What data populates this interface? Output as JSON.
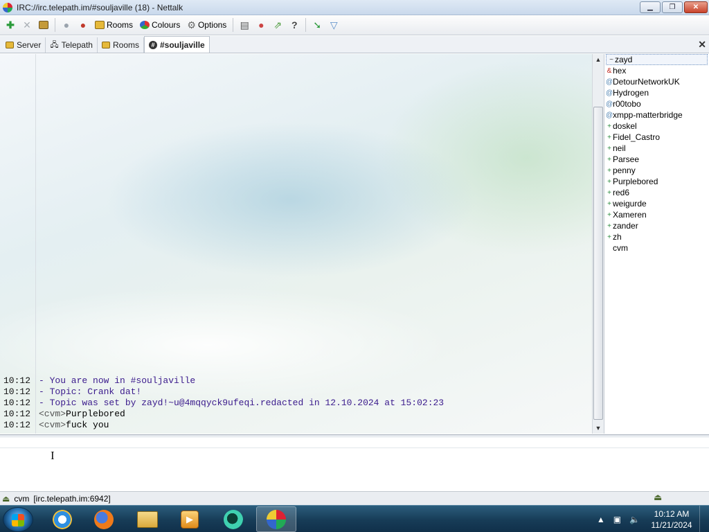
{
  "window": {
    "title": "IRC://irc.telepath.im/#souljaville (18)  -  Nettalk",
    "minimize": "▁",
    "maximize": "❐",
    "close": "✕"
  },
  "toolbar": {
    "rooms": "Rooms",
    "colours": "Colours",
    "options": "Options",
    "help": "?"
  },
  "tabs": [
    {
      "label": "Server"
    },
    {
      "label": "Telepath"
    },
    {
      "label": "Rooms"
    },
    {
      "label": "#souljaville"
    }
  ],
  "tab_close": "✕",
  "messages": [
    {
      "time": "10:12",
      "text": "- You are now in #souljaville"
    },
    {
      "time": "10:12",
      "text": "- Topic: Crank dat!"
    },
    {
      "time": "10:12",
      "text": "- Topic was set by zayd!~u@4mqqyck9ufeqi.redacted in 12.10.2024 at 15:02:23"
    },
    {
      "time": "10:12",
      "nick": "<cvm>",
      "body": "Purplebored"
    },
    {
      "time": "10:12",
      "nick": "<cvm>",
      "body": "fuck you"
    }
  ],
  "users": [
    {
      "mark": "~",
      "name": "zayd",
      "kind": "owner"
    },
    {
      "mark": "&",
      "name": "hex",
      "kind": "admin"
    },
    {
      "mark": "@",
      "name": "DetourNetworkUK",
      "kind": "op"
    },
    {
      "mark": "@",
      "name": "Hydrogen",
      "kind": "op"
    },
    {
      "mark": "@",
      "name": "r00tobo",
      "kind": "op"
    },
    {
      "mark": "@",
      "name": "xmpp-matterbridge",
      "kind": "op"
    },
    {
      "mark": "+",
      "name": "doskel",
      "kind": "voice"
    },
    {
      "mark": "+",
      "name": "Fidel_Castro",
      "kind": "voice"
    },
    {
      "mark": "+",
      "name": "neil",
      "kind": "voice"
    },
    {
      "mark": "+",
      "name": "Parsee",
      "kind": "voice"
    },
    {
      "mark": "+",
      "name": "penny",
      "kind": "voice"
    },
    {
      "mark": "+",
      "name": "Purplebored",
      "kind": "voice"
    },
    {
      "mark": "+",
      "name": "red6",
      "kind": "voice"
    },
    {
      "mark": "+",
      "name": "weigurde",
      "kind": "voice"
    },
    {
      "mark": "+",
      "name": "Xameren",
      "kind": "voice"
    },
    {
      "mark": "+",
      "name": "zander",
      "kind": "voice"
    },
    {
      "mark": "+",
      "name": "zh",
      "kind": "voice"
    },
    {
      "mark": "",
      "name": "cvm",
      "kind": "normal"
    }
  ],
  "statusbar": {
    "nick": "cvm",
    "server": "[irc.telepath.im:6942]"
  },
  "taskbar": {
    "clock_time": "10:12 AM",
    "clock_date": "11/21/2024"
  },
  "colors": {
    "topic_text": "#3a1a8c",
    "owner_mark": "#444444",
    "admin_mark": "#c0281e",
    "op_mark": "#4a7fb0",
    "voice_mark": "#2b8a3e"
  }
}
